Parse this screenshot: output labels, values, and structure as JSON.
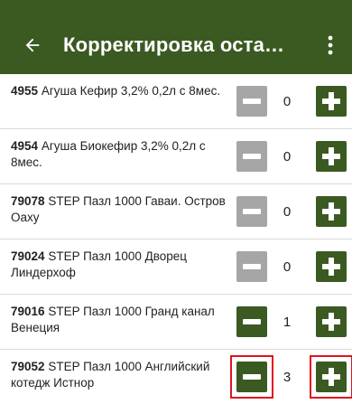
{
  "app": {
    "title": "Корректировка оста…",
    "back_icon": "arrow-left-icon",
    "menu_icon": "more-vert-icon",
    "colors": {
      "primary": "#3b5a22",
      "disabled": "#a6a6a6",
      "highlight": "#e0141e"
    }
  },
  "items": [
    {
      "code": "4955",
      "name": "Агуша Кефир 3,2% 0,2л с 8мес.",
      "qty": "0",
      "minus_enabled": false,
      "highlighted": false
    },
    {
      "code": "4954",
      "name": "Агуша Биокефир 3,2% 0,2л с 8мес.",
      "qty": "0",
      "minus_enabled": false,
      "highlighted": false
    },
    {
      "code": "79078",
      "name": "STEP Пазл 1000 Гаваи. Остров Оаху",
      "qty": "0",
      "minus_enabled": false,
      "highlighted": false
    },
    {
      "code": "79024",
      "name": "STEP Пазл 1000 Дворец Линдерхоф",
      "qty": "0",
      "minus_enabled": false,
      "highlighted": false
    },
    {
      "code": "79016",
      "name": "STEP Пазл 1000 Гранд канал Венеция",
      "qty": "1",
      "minus_enabled": true,
      "highlighted": false
    },
    {
      "code": "79052",
      "name": "STEP Пазл 1000 Английский котедж Истнор",
      "qty": "3",
      "minus_enabled": true,
      "highlighted": true
    }
  ]
}
